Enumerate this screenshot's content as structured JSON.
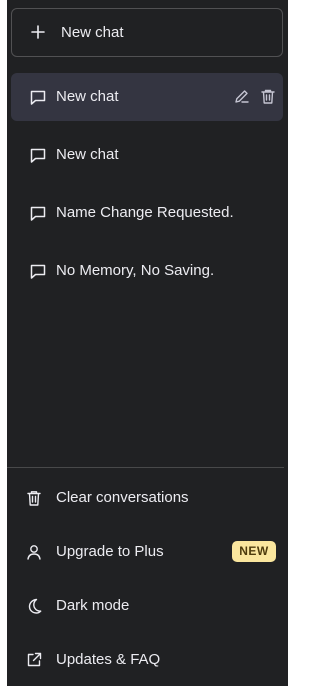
{
  "new_chat_button": {
    "label": "New chat"
  },
  "conversations": [
    {
      "title": "New chat",
      "active": true
    },
    {
      "title": "New chat",
      "active": false
    },
    {
      "title": "Name Change Requested.",
      "active": false
    },
    {
      "title": "No Memory, No Saving.",
      "active": false
    }
  ],
  "menu": {
    "clear": {
      "label": "Clear conversations",
      "icon": "trash-icon"
    },
    "upgrade": {
      "label": "Upgrade to Plus",
      "icon": "user-icon",
      "badge": "NEW"
    },
    "dark_mode": {
      "label": "Dark mode",
      "icon": "moon-icon"
    },
    "updates": {
      "label": "Updates & FAQ",
      "icon": "external-link-icon"
    }
  },
  "colors": {
    "sidebar_bg": "#202123",
    "active_bg": "#343541",
    "text": "#ececf1",
    "badge_bg": "#fae69e"
  }
}
